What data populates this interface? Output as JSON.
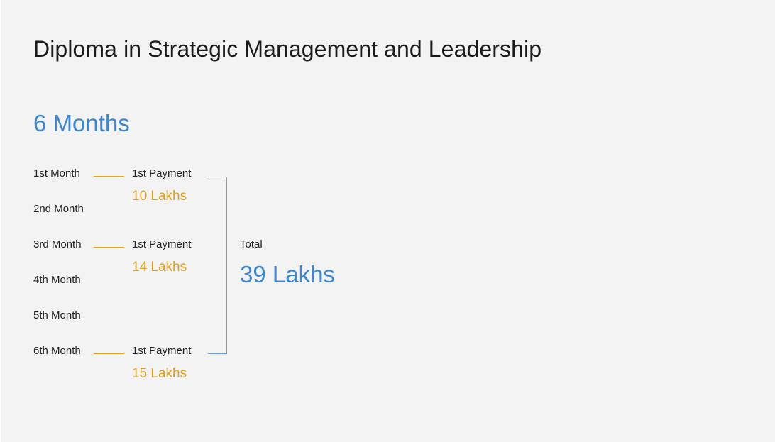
{
  "title": "Diploma in Strategic Management and Leadership",
  "duration": "6 Months",
  "months": [
    "1st Month",
    "2nd Month",
    "3rd Month",
    "4th Month",
    "5th Month",
    "6th Month"
  ],
  "payments": [
    {
      "month": "1st Month",
      "label": "1st Payment",
      "amount": "10 Lakhs"
    },
    {
      "month": "3rd Month",
      "label": "1st Payment",
      "amount": "14 Lakhs"
    },
    {
      "month": "6th Month",
      "label": "1st Payment",
      "amount": "15 Lakhs"
    }
  ],
  "total": {
    "label": "Total",
    "value": "39 Lakhs"
  },
  "colors": {
    "background": "#f3f3f3",
    "accent_blue": "#3a86d4",
    "accent_orange": "#e39f14",
    "bracket_blue": "#6a9fdc",
    "connector_orange": "#e8a317",
    "text": "#1f1f1f"
  }
}
